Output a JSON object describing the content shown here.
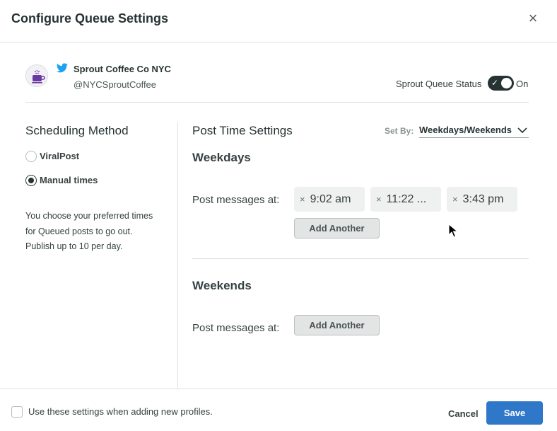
{
  "modal": {
    "title": "Configure Queue Settings",
    "close_icon": "close-icon"
  },
  "profile": {
    "avatar_icon": "coffee-cup-icon",
    "network_icon": "twitter-bird-icon",
    "name": "Sprout Coffee Co NYC",
    "handle": "@NYCSproutCoffee"
  },
  "queue_status": {
    "label": "Sprout Queue Status",
    "enabled": true,
    "state_label": "On"
  },
  "scheduling": {
    "title": "Scheduling Method",
    "options": [
      {
        "label": "ViralPost",
        "selected": false
      },
      {
        "label": "Manual times",
        "selected": true
      }
    ],
    "description": "You choose your preferred times for Queued posts to go out. Publish up to 10 per day."
  },
  "post_time": {
    "title": "Post Time Settings",
    "set_by_label": "Set By:",
    "set_by_value": "Weekdays/Weekends",
    "weekdays": {
      "title": "Weekdays",
      "post_at_label": "Post messages at:",
      "times": [
        "9:02 am",
        "11:22 ...",
        "3:43 pm"
      ],
      "remove_symbol": "×",
      "add_label": "Add Another"
    },
    "weekends": {
      "title": "Weekends",
      "post_at_label": "Post messages at:",
      "add_label": "Add Another"
    }
  },
  "footer": {
    "checkbox_label": "Use these settings when adding new profiles.",
    "checkbox_checked": false,
    "cancel_label": "Cancel",
    "save_label": "Save"
  },
  "colors": {
    "primary": "#2f77c9",
    "toggle_on": "#273333",
    "twitter_blue": "#1da1f2"
  }
}
